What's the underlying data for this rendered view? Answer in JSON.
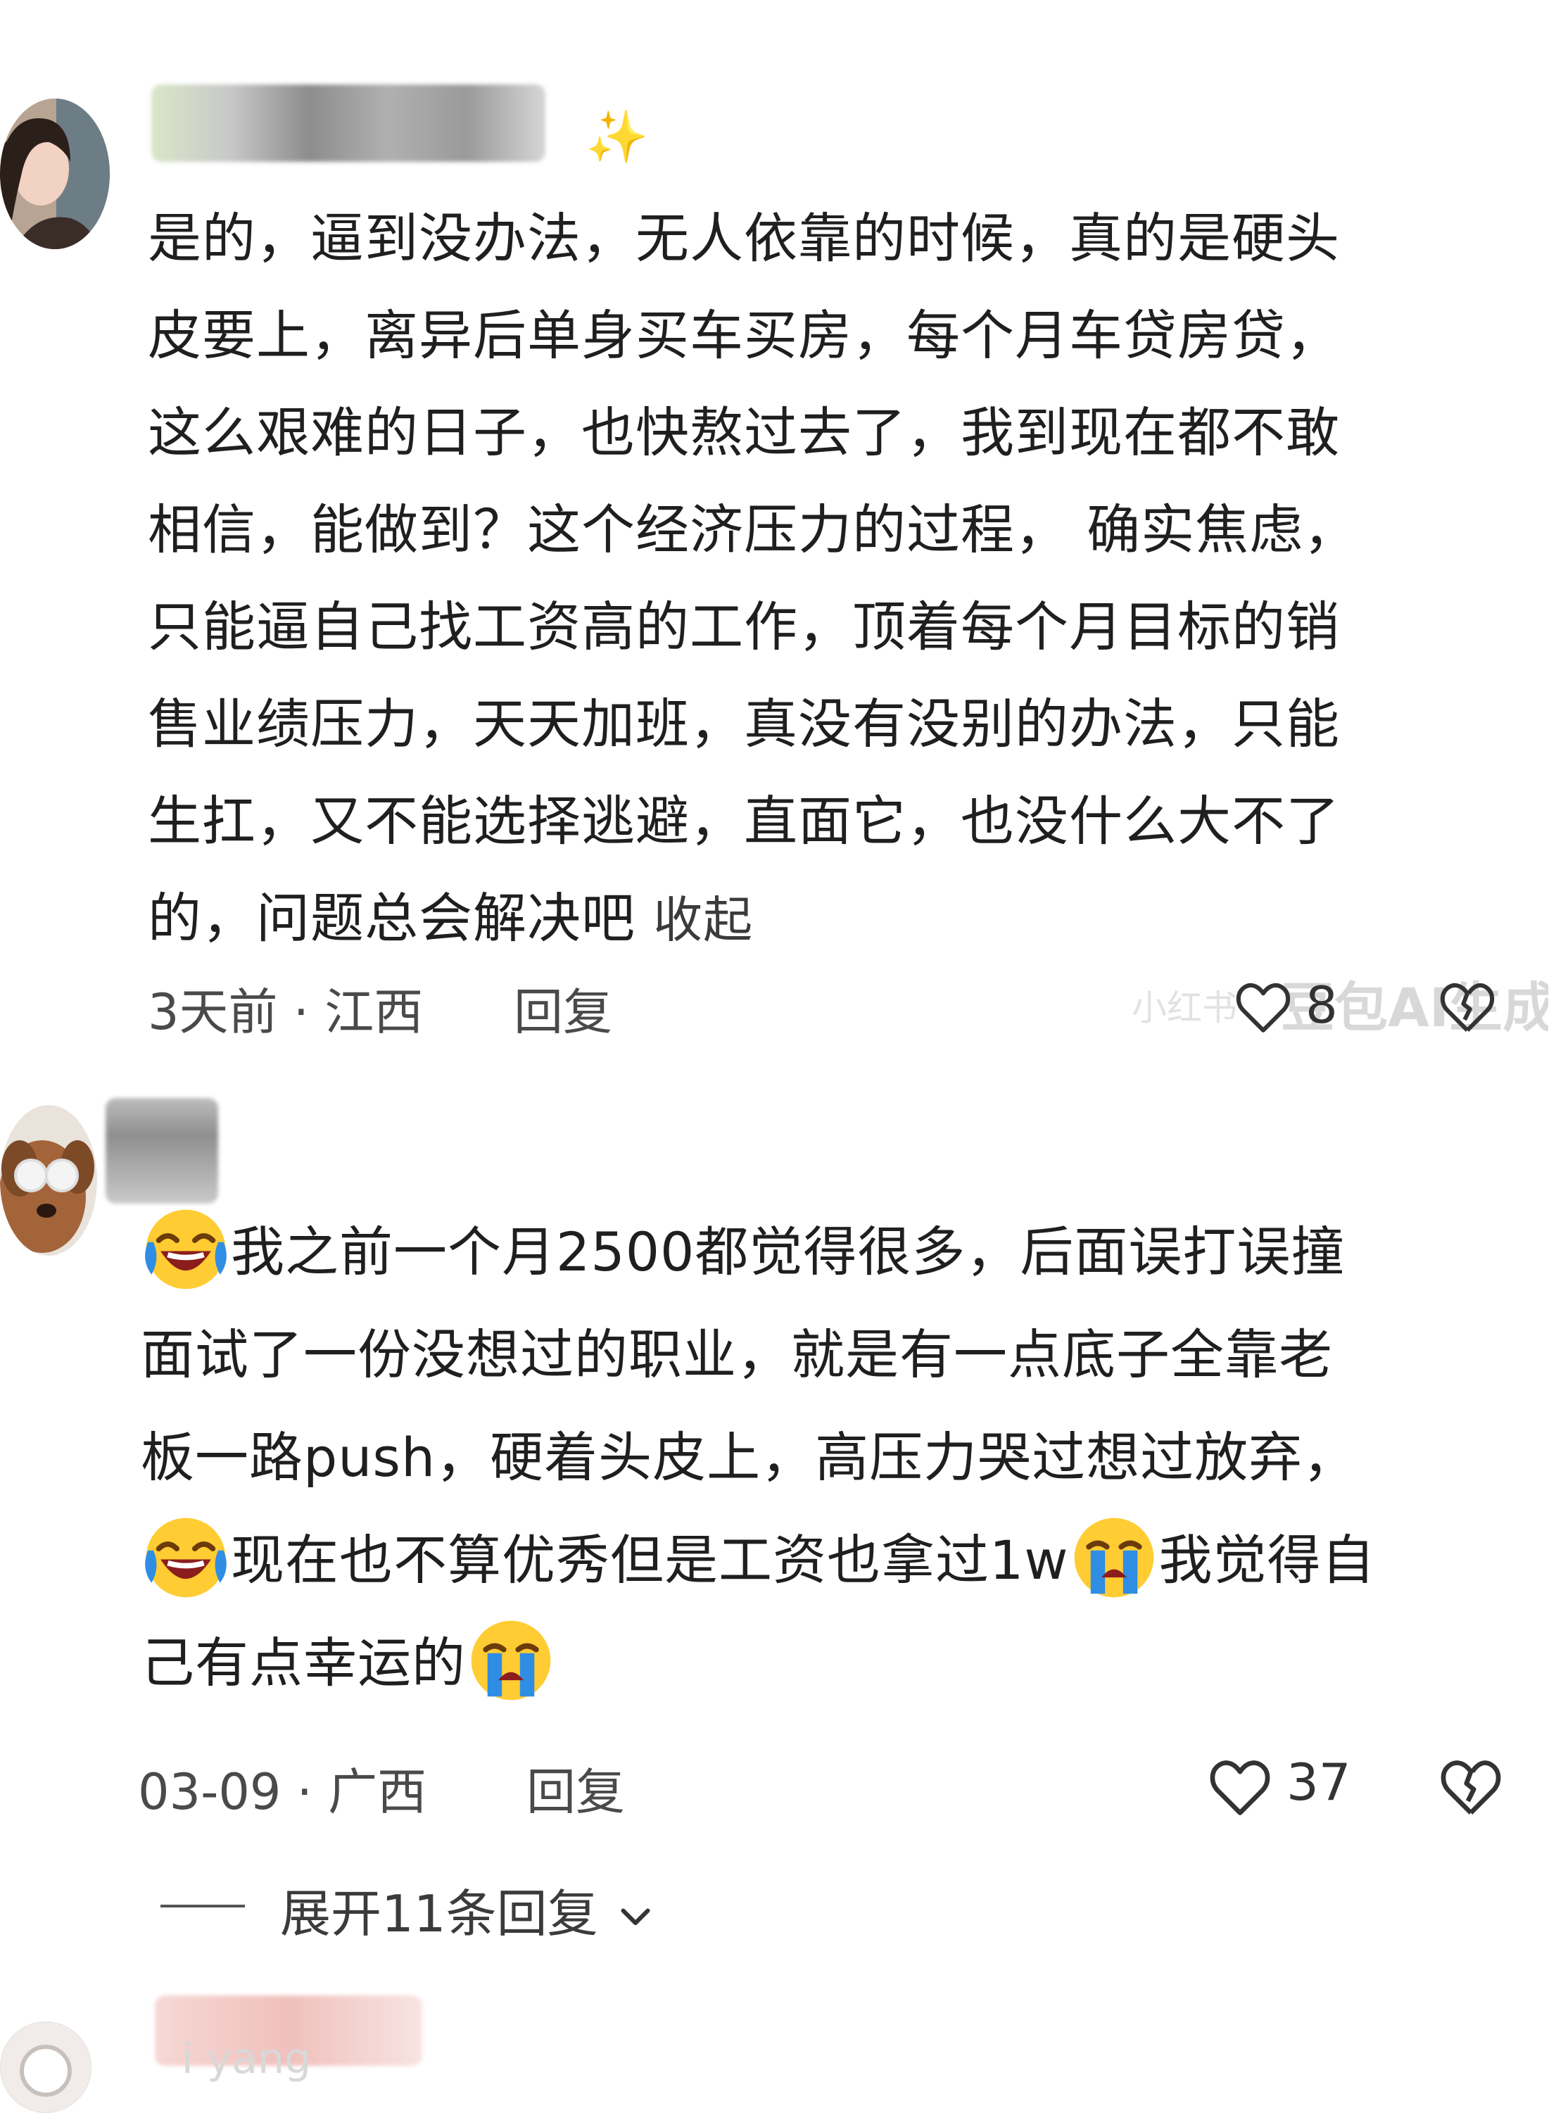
{
  "comments": [
    {
      "lines": [
        "是的，逼到没办法，无人依靠的时候，真的是硬头",
        "皮要上，离异后单身买车买房，每个月车贷房贷，",
        "这么艰难的日子，也快熬过去了，我到现在都不敢",
        "相信，能做到？这个经济压力的过程， 确实焦虑，",
        "只能逼自己找工资高的工作，顶着每个月目标的销",
        "售业绩压力，天天加班，真没有没别的办法，只能",
        "生扛，又不能选择逃避，直面它，也没什么大不了",
        "的，问题总会解决吧"
      ],
      "collapse_label": "收起",
      "time_location": "3天前 · 江西",
      "reply_label": "回复",
      "likes": "8",
      "avatar_icon": "woman-portrait-avatar",
      "badge_icon": "sparkle-icon"
    },
    {
      "line1": "我之前一个月2500都觉得很多，后面误打误撞",
      "line2": "面试了一份没想过的职业，就是有一点底子全靠老",
      "line3": "板一路push，硬着头皮上，高压力哭过想过放弃，",
      "line4_a": "现在也不算优秀但是工资也拿过1w",
      "line4_b": "我觉得自",
      "line5": "己有点幸运的",
      "time_location": "03-09 · 广西",
      "reply_label": "回复",
      "likes": "37",
      "avatar_icon": "dog-with-glasses-avatar",
      "emoji_icons": [
        "laughing-crying-emoji",
        "loudly-crying-emoji"
      ]
    }
  ],
  "expand_replies_label": "展开11条回复",
  "watermark_text": "小红书",
  "watermark_text2": "豆包AI生成",
  "third_user_name": "i yang",
  "colors": {
    "text": "#1f1f1f",
    "meta": "#4a4a4a",
    "background": "#ffffff",
    "emoji_face": "#ffcc33",
    "emoji_tears": "#2f8de4"
  }
}
